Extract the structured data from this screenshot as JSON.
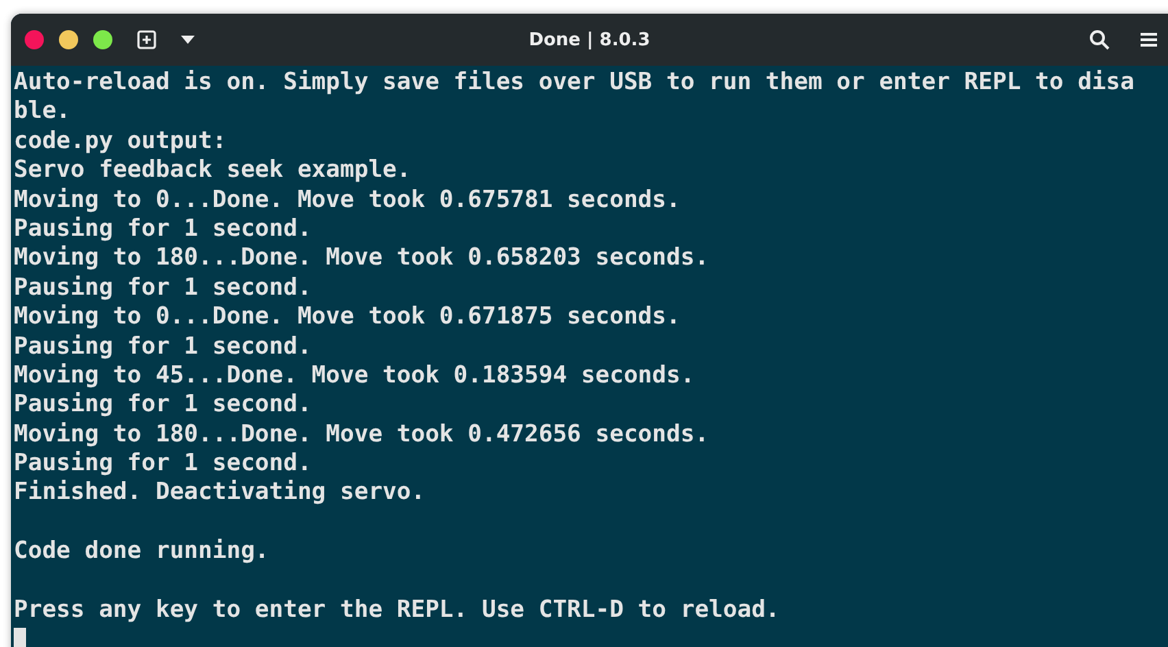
{
  "window": {
    "title": "Done | 8.0.3"
  },
  "terminal": {
    "lines": [
      {
        "kind": "text",
        "text": "Auto-reload is on. Simply save files over USB to run them or enter REPL to disa"
      },
      {
        "kind": "text",
        "text": "ble."
      },
      {
        "kind": "text",
        "text": "code.py output:"
      },
      {
        "kind": "text",
        "text": "Servo feedback seek example."
      },
      {
        "kind": "text",
        "text": "Moving to 0...Done. Move took 0.675781 seconds."
      },
      {
        "kind": "text",
        "text": "Pausing for 1 second."
      },
      {
        "kind": "text",
        "text": "Moving to 180...Done. Move took 0.658203 seconds."
      },
      {
        "kind": "text",
        "text": "Pausing for 1 second."
      },
      {
        "kind": "text",
        "text": "Moving to 0...Done. Move took 0.671875 seconds."
      },
      {
        "kind": "text",
        "text": "Pausing for 1 second."
      },
      {
        "kind": "text",
        "text": "Moving to 45...Done. Move took 0.183594 seconds."
      },
      {
        "kind": "text",
        "text": "Pausing for 1 second."
      },
      {
        "kind": "text",
        "text": "Moving to 180...Done. Move took 0.472656 seconds."
      },
      {
        "kind": "text",
        "text": "Pausing for 1 second."
      },
      {
        "kind": "text",
        "text": "Finished. Deactivating servo."
      },
      {
        "kind": "blank"
      },
      {
        "kind": "text",
        "text": "Code done running."
      },
      {
        "kind": "blank"
      },
      {
        "kind": "text",
        "text": "Press any key to enter the REPL. Use CTRL-D to reload."
      },
      {
        "kind": "cursor"
      }
    ]
  }
}
